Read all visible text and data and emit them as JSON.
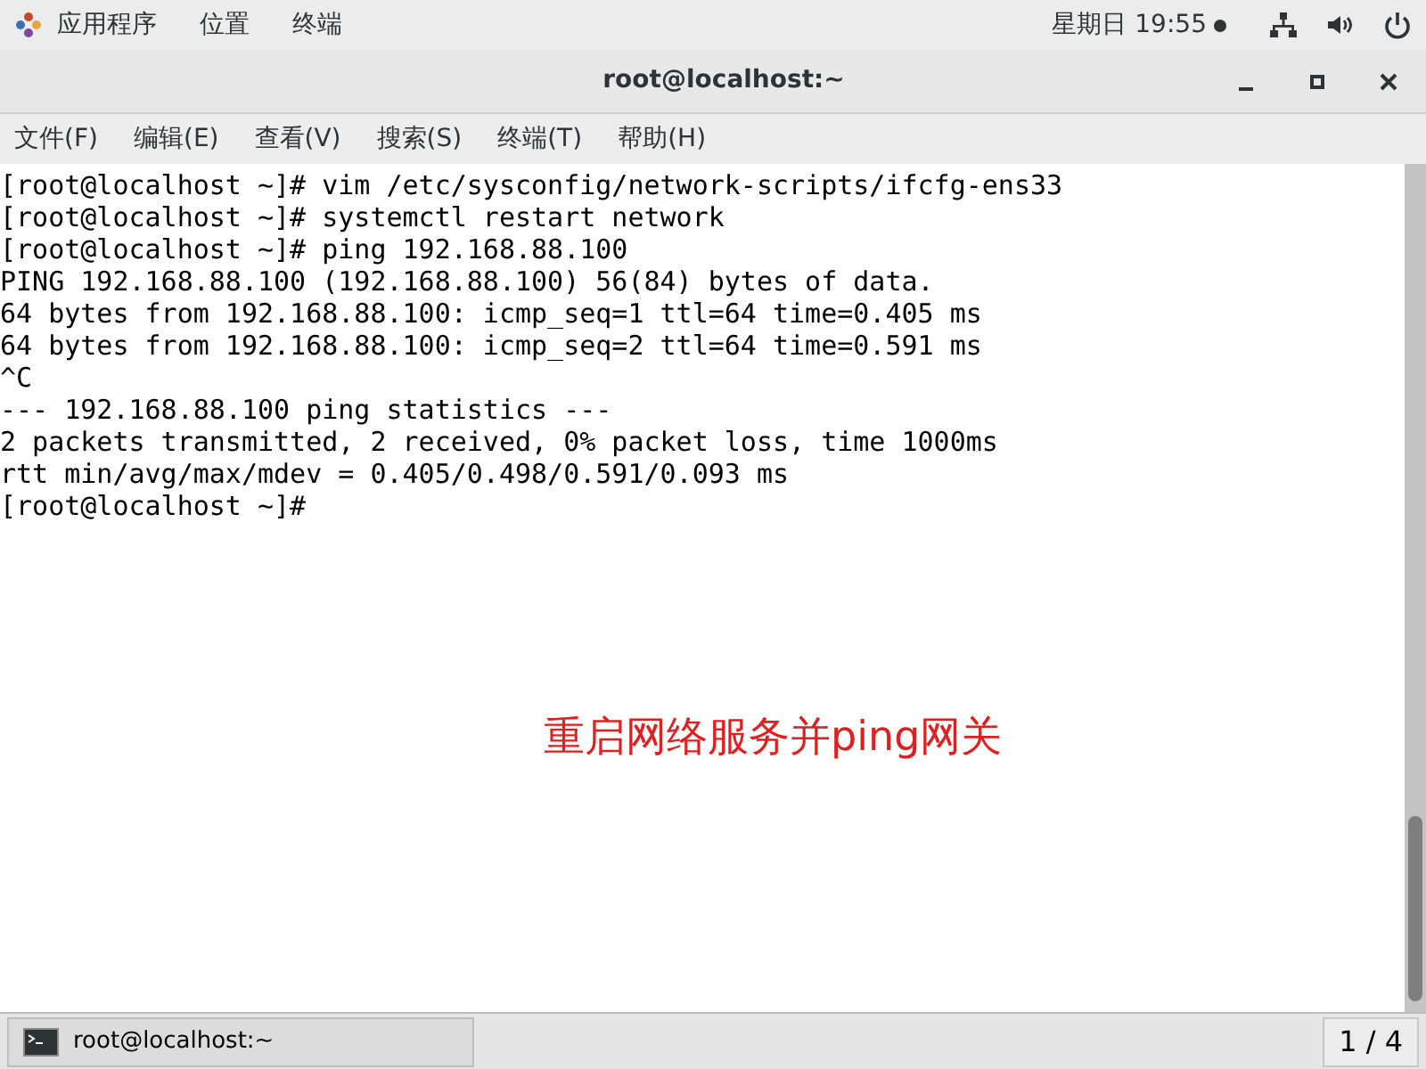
{
  "top_panel": {
    "menus": [
      "应用程序",
      "位置",
      "终端"
    ],
    "clock": "星期日 19:55"
  },
  "window": {
    "title": "root@localhost:~",
    "menu_bar": [
      "文件(F)",
      "编辑(E)",
      "查看(V)",
      "搜索(S)",
      "终端(T)",
      "帮助(H)"
    ],
    "terminal_lines": [
      "[root@localhost ~]# vim /etc/sysconfig/network-scripts/ifcfg-ens33",
      "[root@localhost ~]# systemctl restart network",
      "[root@localhost ~]# ping 192.168.88.100",
      "PING 192.168.88.100 (192.168.88.100) 56(84) bytes of data.",
      "64 bytes from 192.168.88.100: icmp_seq=1 ttl=64 time=0.405 ms",
      "64 bytes from 192.168.88.100: icmp_seq=2 ttl=64 time=0.591 ms",
      "^C",
      "--- 192.168.88.100 ping statistics ---",
      "2 packets transmitted, 2 received, 0% packet loss, time 1000ms",
      "rtt min/avg/max/mdev = 0.405/0.498/0.591/0.093 ms",
      "[root@localhost ~]#"
    ],
    "annotation": "重启网络服务并ping网关"
  },
  "taskbar": {
    "task": "root@localhost:~",
    "workspace": "1 / 4"
  }
}
